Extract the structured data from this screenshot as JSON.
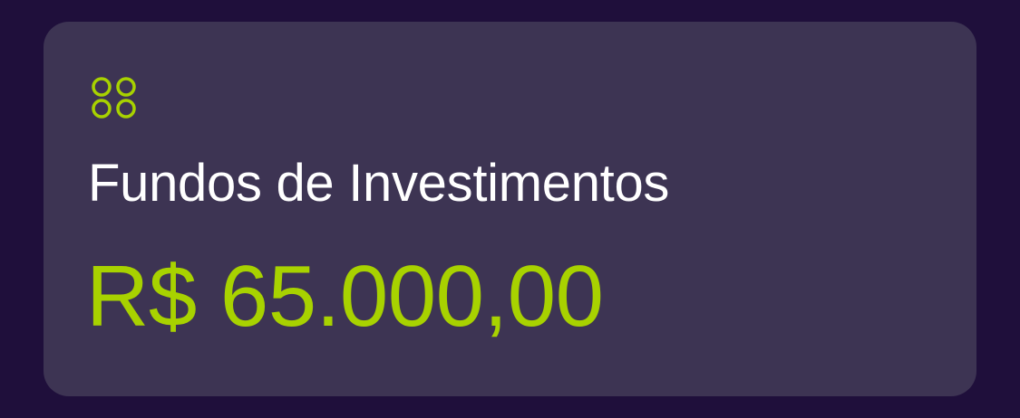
{
  "card": {
    "icon": "four-circles-icon",
    "title": "Fundos de Investimentos",
    "value": "R$ 65.000,00"
  },
  "colors": {
    "background": "#1f0f3b",
    "card_background": "#3d3453",
    "accent": "#a8d200",
    "title_text": "#ffffff"
  }
}
